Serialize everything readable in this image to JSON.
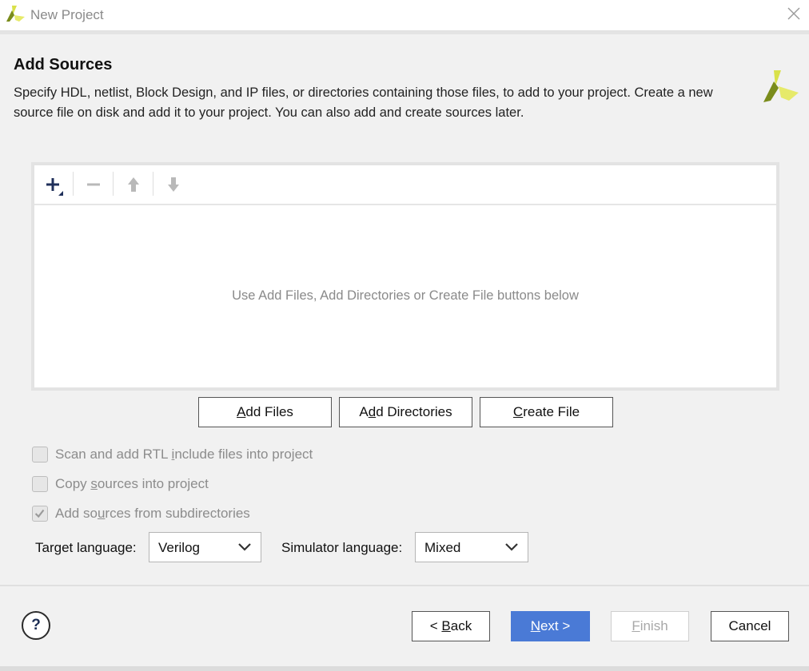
{
  "window": {
    "title": "New Project",
    "close_icon": "close-icon"
  },
  "page": {
    "heading": "Add Sources",
    "description": "Specify HDL, netlist, Block Design, and IP files, or directories containing those files, to add to your project. Create a new source file on disk and add it to your project. You can also add and create sources later."
  },
  "sources_panel": {
    "toolbar": {
      "add_icon": "plus-icon",
      "remove_icon": "minus-icon",
      "up_icon": "arrow-up-icon",
      "down_icon": "arrow-down-icon"
    },
    "empty_message": "Use Add Files, Add Directories or Create File buttons below"
  },
  "actions": {
    "add_files": {
      "pre": "",
      "key": "A",
      "post": "dd Files"
    },
    "add_directories": {
      "pre": "A",
      "key": "d",
      "post": "d Directories"
    },
    "create_file": {
      "pre": "",
      "key": "C",
      "post": "reate File"
    }
  },
  "options": {
    "scan_rtl": {
      "pre": "Scan and add RTL ",
      "key": "i",
      "post": "nclude files into project",
      "checked": false,
      "enabled": false
    },
    "copy_sources": {
      "pre": "Copy ",
      "key": "s",
      "post": "ources into project",
      "checked": false,
      "enabled": false
    },
    "add_subdirs": {
      "pre": "Add so",
      "key": "u",
      "post": "rces from subdirectories",
      "checked": true,
      "enabled": false
    }
  },
  "languages": {
    "target_label": "Target language:",
    "target_value": "Verilog",
    "simulator_label": "Simulator language:",
    "simulator_value": "Mixed"
  },
  "footer": {
    "help_label": "?",
    "back": {
      "pre": "< ",
      "key": "B",
      "post": "ack"
    },
    "next": {
      "pre": "",
      "key": "N",
      "post": "ext >"
    },
    "finish": {
      "pre": "",
      "key": "F",
      "post": "inish"
    },
    "cancel_label": "Cancel"
  },
  "colors": {
    "primary_button": "#4a7ad6",
    "logo_green": "#7a8c1b",
    "logo_yellow": "#d9e14a"
  }
}
